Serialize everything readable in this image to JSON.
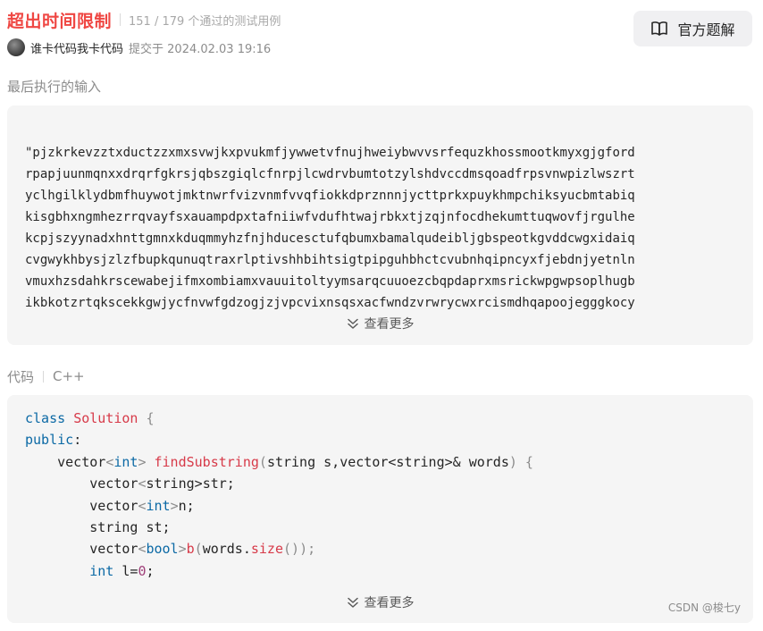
{
  "status": {
    "title": "超出时间限制",
    "passed": "151 / 179 个通过的测试用例"
  },
  "author": {
    "name": "谁卡代码我卡代码",
    "submitted": "提交于 2024.02.03 19:16"
  },
  "solution_button": {
    "label": "官方题解"
  },
  "input_section": {
    "label": "最后执行的输入",
    "lines": [
      "\"pjzkrkevzztxductzzxmxsvwjkxpvukmfjywwetvfnujhweiybwvvsrfequzkhossmootkmyxgjgford",
      "rpapjuunmqnxxdrqrfgkrsjqbszgiqlcfnrpjlcwdrvbumtotzylshdvccdmsqoadfrpsvnwpizlwszrt",
      "yclhgilklydbmfhuywotjmktnwrfvizvnmfvvqfiokkdprznnnjycttprkxpuykhmpchiksyucbmtabiq",
      "kisgbhxngmhezrrqvayfsxauampdpxtafniiwfvdufhtwajrbkxtjzqjnfocdhekumttuqwovfjrgulhe",
      "kcpjszyynadxhnttgmnxkduqmmyhzfnjhducesctufqbumxbamalqudeibljgbspeotkgvddcwgxidaiq",
      "cvgwykhbysjzlzfbupkqunuqtraxrlptivshhbihtsigtpipguhbhctcvubnhqipncyxfjebdnjyetnln",
      "vmuxhzsdahkrscewabejifmxombiamxvauuitoltyymsarqcuuoezcbqpdaprxmsrickwpgwpsoplhugb",
      "ikbkotzrtqkscekkgwjycfnvwfgdzogjzjvpcvixnsqsxacfwndzvrwrycwxrcismdhqapoojegggkocy"
    ],
    "more_label": "查看更多"
  },
  "code_section": {
    "label": "代码",
    "language": "C++",
    "more_label": "查看更多"
  },
  "code_lines": {
    "l1": [
      "class",
      " ",
      "Solution",
      " {"
    ],
    "l2": [
      "public",
      ":"
    ],
    "l3": [
      "    vector",
      "<",
      "int",
      ">",
      " ",
      "findSubstring",
      "(",
      "string s,vector<string>& words",
      ")",
      " {"
    ],
    "l4": [
      "        vector",
      "<",
      "string",
      ">",
      "str;"
    ],
    "l5": [
      "        vector",
      "<",
      "int",
      ">",
      "n;"
    ],
    "l6": [
      "        string st;"
    ],
    "l7": [
      "        vector",
      "<",
      "bool",
      ">",
      "b",
      "(",
      "words.",
      "size",
      "()",
      ");"
    ],
    "l8": [
      "        ",
      "int",
      " l=",
      "0",
      ";"
    ]
  },
  "watermark": "CSDN @梭七y",
  "colors": {
    "status_error": "#ef4743",
    "keyword": "#0b69a5",
    "class_name": "#d73a49",
    "panel_bg": "#f5f5f5"
  },
  "icons": {
    "solution": "book-icon",
    "expand": "chevron-double-down-icon"
  }
}
